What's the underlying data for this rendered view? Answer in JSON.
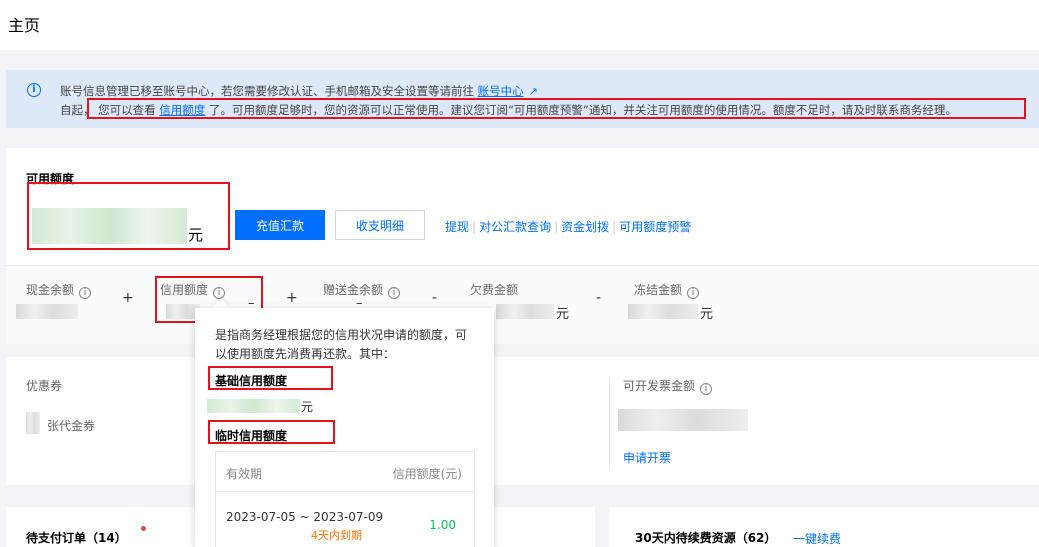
{
  "page": {
    "title": "主页"
  },
  "notice": {
    "line1_text": "账号信息管理已移至账号中心，若您需要修改认证、手机邮箱及安全设置等请前往",
    "line1_link": "账号中心",
    "line2_prefix": "自起，",
    "line2_text1": "您可以查看",
    "line2_link": "信用额度",
    "line2_text2": "了。可用额度足够时，您的资源可以正常使用。建议您订阅“可用额度预警”通知，并关注可用额度的使用情况。额度不足时，请及时联系商务经理。"
  },
  "balance": {
    "title": "可用额度",
    "unit": "元",
    "recharge_button": "充值汇款",
    "statement_button": "收支明细",
    "links": [
      "提现",
      "对公汇款查询",
      "资金划拨",
      "可用额度预警"
    ]
  },
  "metrics": {
    "cash": "现金余额",
    "credit": "信用额度",
    "gift": "赠送金余额",
    "arrears": "欠费金额",
    "frozen": "冻结金额",
    "unit": "元",
    "plus": "+",
    "minus": "-",
    "dash": "–"
  },
  "coupon": {
    "label": "优惠券",
    "count_suffix": "张代金券"
  },
  "invoice": {
    "label": "可开发票金额",
    "apply_link": "申请开票"
  },
  "orders": {
    "title": "待支付订单（14）"
  },
  "renewal": {
    "title": "30天内待续费资源（62）",
    "link": "一键续费"
  },
  "tooltip": {
    "description": "是指商务经理根据您的信用状况申请的额度，可以使用额度先消费再还款。其中：",
    "basic_title": "基础信用额度",
    "basic_unit": "元",
    "temp_title": "临时信用额度",
    "table": {
      "col_validity": "有效期",
      "col_amount": "信用额度(元)",
      "rows": [
        {
          "period": "2023-07-05 ~ 2023-07-09",
          "amount": "1.00",
          "status": "4天内到期"
        }
      ]
    }
  },
  "colors": {
    "primary": "#006eff",
    "highlight_box": "#e1141e",
    "success": "#0abf5b",
    "warning": "#ff7200"
  },
  "icons": [
    "info-icon",
    "external-link-icon",
    "question-circle-icon"
  ]
}
